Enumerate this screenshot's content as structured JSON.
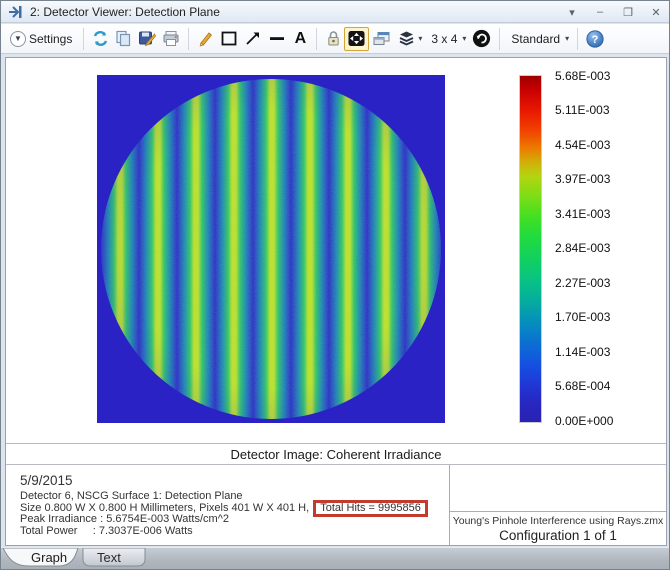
{
  "window": {
    "title": "2: Detector Viewer: Detection Plane",
    "icons": {
      "menu_caret": "▾",
      "minimize": "–",
      "maximize": "❐",
      "close": "✕"
    }
  },
  "toolbar": {
    "settings_label": "Settings",
    "grid_label": "3 x 4",
    "standard_label": "Standard",
    "caret": "▾"
  },
  "plot": {
    "caption": "Detector Image: Coherent Irradiance",
    "colorbar_labels": [
      "5.68E-003",
      "5.11E-003",
      "4.54E-003",
      "3.97E-003",
      "3.41E-003",
      "2.84E-003",
      "2.27E-003",
      "1.70E-003",
      "1.14E-003",
      "5.68E-004",
      "0.00E+000"
    ]
  },
  "chart_data": {
    "type": "heatmap",
    "title": "Detector Image: Coherent Irradiance",
    "description": "Circular detector showing vertical two-pinhole interference fringes (about 9 bright vertical bands) on a dark blue background square",
    "detector_size": "0.800 W X 0.800 H Millimeters",
    "pixels": "401 W X 401 H",
    "value_scale": [
      "0.00E+000",
      "5.68E-004",
      "1.14E-003",
      "1.70E-003",
      "2.27E-003",
      "2.84E-003",
      "3.41E-003",
      "3.97E-003",
      "4.54E-003",
      "5.11E-003",
      "5.68E-003"
    ],
    "units": "Watts/cm^2",
    "colormap": "false-color (dark blue -> blue -> cyan -> green -> yellow -> orange -> red)"
  },
  "footer": {
    "date": "5/9/2015",
    "line1": "Detector 6, NSCG Surface 1: Detection Plane",
    "line2_prefix": "Size 0.800 W X 0.800 H Millimeters, Pixels 401 W X 401 H, ",
    "line2_highlight": "Total Hits = 9995856",
    "line3": "Peak Irradiance : 5.6754E-003 Watts/cm^2",
    "line4": "Total Power     : 7.3037E-006 Watts",
    "file_name": "Young's Pinhole Interference using Rays.zmx",
    "configuration": "Configuration 1 of 1"
  },
  "tabs": {
    "graph": "Graph",
    "text": "Text"
  },
  "colors": {
    "plot_background": "#2a22c4",
    "fringe_bright": "#bce42a",
    "fringe_dark": "#2a2ec8",
    "annotation_box": "#c23b2e",
    "highlight_button": "#fdf3cd"
  }
}
